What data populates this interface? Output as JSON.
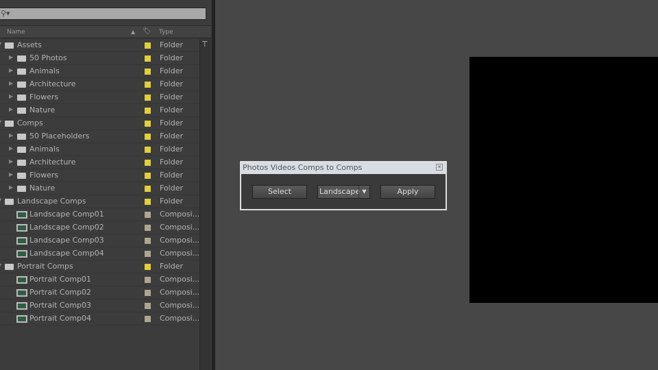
{
  "project": {
    "search_placeholder": "",
    "columns": {
      "name": "Name",
      "type": "Type"
    },
    "items": [
      {
        "name": "Assets",
        "level": 0,
        "kind": "folder",
        "expanded": true,
        "label": "#e2cf3a",
        "type": "Folder"
      },
      {
        "name": "50 Photos",
        "level": 1,
        "kind": "folder",
        "label": "#e2cf3a",
        "type": "Folder"
      },
      {
        "name": "Animals",
        "level": 1,
        "kind": "folder",
        "label": "#e2cf3a",
        "type": "Folder"
      },
      {
        "name": "Architecture",
        "level": 1,
        "kind": "folder",
        "label": "#e2cf3a",
        "type": "Folder"
      },
      {
        "name": "Flowers",
        "level": 1,
        "kind": "folder",
        "label": "#e2cf3a",
        "type": "Folder"
      },
      {
        "name": "Nature",
        "level": 1,
        "kind": "folder",
        "label": "#e2cf3a",
        "type": "Folder"
      },
      {
        "name": "Comps",
        "level": 0,
        "kind": "folder",
        "expanded": true,
        "label": "#e2cf3a",
        "type": "Folder"
      },
      {
        "name": "50 Placeholders",
        "level": 1,
        "kind": "folder",
        "label": "#e2cf3a",
        "type": "Folder"
      },
      {
        "name": "Animals",
        "level": 1,
        "kind": "folder",
        "label": "#e2cf3a",
        "type": "Folder"
      },
      {
        "name": "Architecture",
        "level": 1,
        "kind": "folder",
        "label": "#e2cf3a",
        "type": "Folder"
      },
      {
        "name": "Flowers",
        "level": 1,
        "kind": "folder",
        "label": "#e2cf3a",
        "type": "Folder"
      },
      {
        "name": "Nature",
        "level": 1,
        "kind": "folder",
        "label": "#e2cf3a",
        "type": "Folder"
      },
      {
        "name": "Landscape Comps",
        "level": 0,
        "kind": "folder",
        "expanded": true,
        "label": "#e2cf3a",
        "type": "Folder"
      },
      {
        "name": "Landscape Comp01",
        "level": 1,
        "kind": "comp",
        "label": "#b0a690",
        "type": "Composi..."
      },
      {
        "name": "Landscape Comp02",
        "level": 1,
        "kind": "comp",
        "label": "#b0a690",
        "type": "Composi..."
      },
      {
        "name": "Landscape Comp03",
        "level": 1,
        "kind": "comp",
        "label": "#b0a690",
        "type": "Composi..."
      },
      {
        "name": "Landscape Comp04",
        "level": 1,
        "kind": "comp",
        "label": "#b0a690",
        "type": "Composi..."
      },
      {
        "name": "Portrait Comps",
        "level": 0,
        "kind": "folder",
        "expanded": true,
        "label": "#e2cf3a",
        "type": "Folder"
      },
      {
        "name": "Portrait Comp01",
        "level": 1,
        "kind": "comp",
        "label": "#b0a690",
        "type": "Composi..."
      },
      {
        "name": "Portrait Comp02",
        "level": 1,
        "kind": "comp",
        "label": "#b0a690",
        "type": "Composi..."
      },
      {
        "name": "Portrait Comp03",
        "level": 1,
        "kind": "comp",
        "label": "#b0a690",
        "type": "Composi..."
      },
      {
        "name": "Portrait Comp04",
        "level": 1,
        "kind": "comp",
        "label": "#b0a690",
        "type": "Composi..."
      }
    ]
  },
  "dialog": {
    "title": "Photos Videos Comps to Comps",
    "select": "Select",
    "dropdown": "Landscape",
    "apply": "Apply"
  }
}
